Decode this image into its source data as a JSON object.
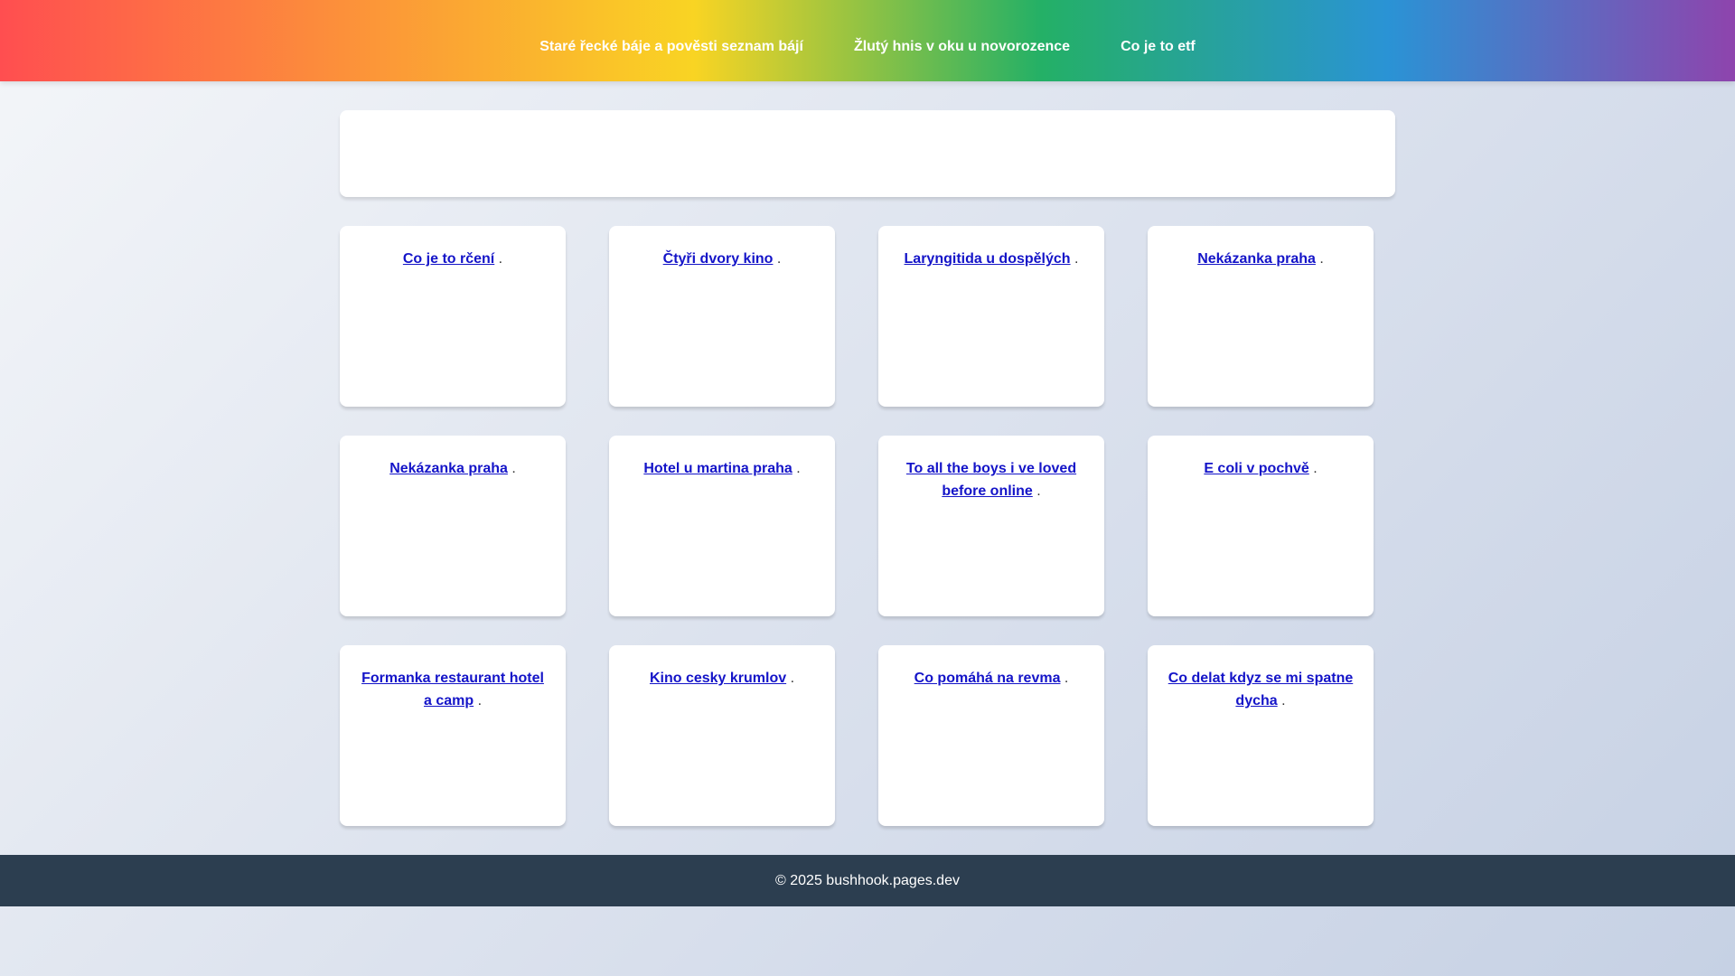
{
  "nav": {
    "links": [
      "Staré řecké báje a pověsti seznam bájí",
      "Žlutý hnis v oku u novorozence",
      "Co je to etf"
    ]
  },
  "cards": [
    {
      "link": "Co je to rčení",
      "suffix": " ."
    },
    {
      "link": "Čtyři dvory kino",
      "suffix": " ."
    },
    {
      "link": "Laryngitida u dospělých",
      "suffix": " ."
    },
    {
      "link": "Nekázanka praha",
      "suffix": " ."
    },
    {
      "link": "Nekázanka praha",
      "suffix": " ."
    },
    {
      "link": "Hotel u martina praha",
      "suffix": " ."
    },
    {
      "link": "To all the boys i ve loved before online",
      "suffix": " ."
    },
    {
      "link": "E coli v pochvě",
      "suffix": " ."
    },
    {
      "link": "Formanka restaurant hotel a camp",
      "suffix": " ."
    },
    {
      "link": "Kino cesky krumlov",
      "suffix": " ."
    },
    {
      "link": "Co pomáhá na revma",
      "suffix": " ."
    },
    {
      "link": "Co delat kdyz se mi spatne dycha",
      "suffix": " ."
    }
  ],
  "footer": {
    "text": "© 2025 bushhook.pages.dev"
  },
  "colors": {
    "footer_bg": "#2c3e50",
    "link": "#1414c8"
  }
}
